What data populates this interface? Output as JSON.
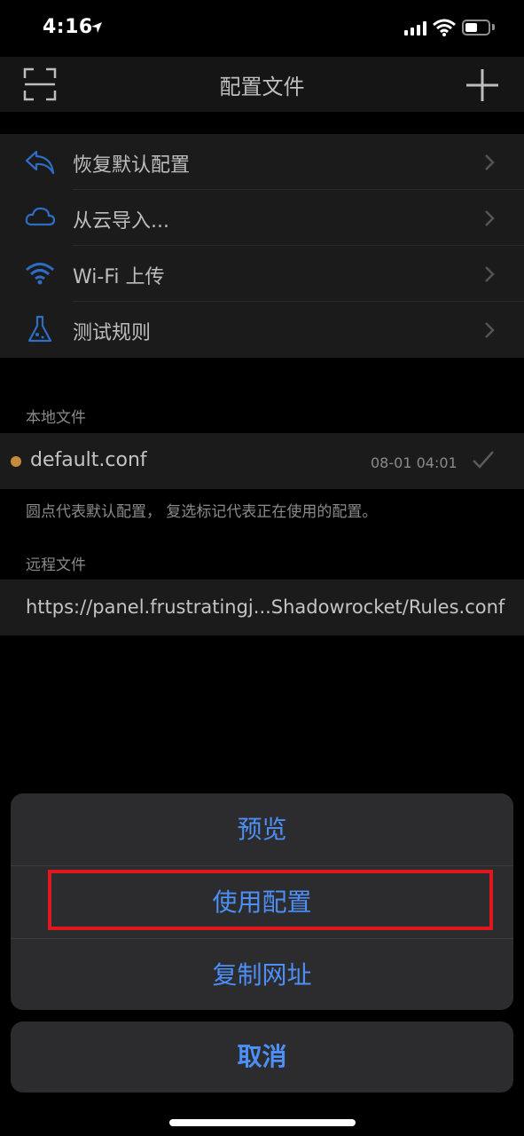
{
  "status_bar": {
    "time": "4:16"
  },
  "navbar": {
    "title": "配置文件"
  },
  "menu": {
    "items": [
      {
        "label": "恢复默认配置",
        "icon": "undo-icon"
      },
      {
        "label": "从云导入...",
        "icon": "cloud-icon"
      },
      {
        "label": "Wi-Fi 上传",
        "icon": "wifi-icon"
      },
      {
        "label": "测试规则",
        "icon": "flask-icon"
      }
    ]
  },
  "local_files": {
    "header": "本地文件",
    "file": {
      "name": "default.conf",
      "date": "08-01 04:01"
    },
    "footnote": "圆点代表默认配置， 复选标记代表正在使用的配置。"
  },
  "remote_files": {
    "header": "远程文件",
    "url": "https://panel.frustratingj...Shadowrocket/Rules.conf"
  },
  "action_sheet": {
    "preview": "预览",
    "use_config": "使用配置",
    "copy_url": "复制网址",
    "cancel": "取消"
  },
  "colors": {
    "accent": "#4c8ff7",
    "icon_blue": "#2e6dc4",
    "highlight": "#e0171f",
    "default_dot": "#c58a3c"
  }
}
